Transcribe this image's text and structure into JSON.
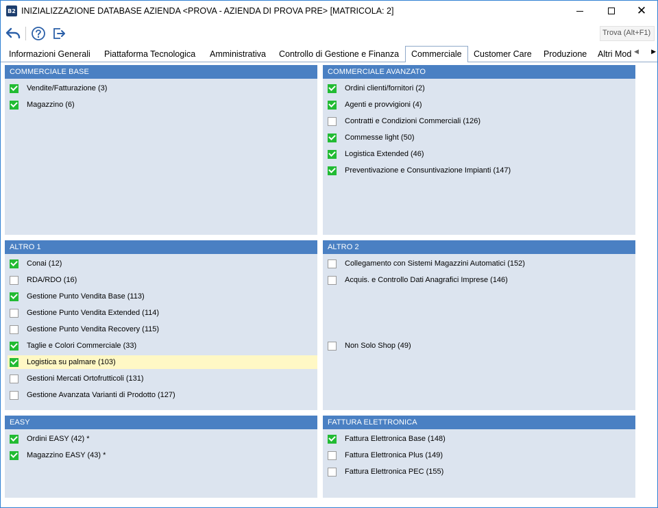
{
  "window": {
    "title": "INIZIALIZZAZIONE DATABASE AZIENDA <PROVA - AZIENDA DI PROVA PRE>   [MATRICOLA: 2]",
    "icon_text": "B2"
  },
  "toolbar": {
    "find_placeholder": "Trova (Alt+F1)"
  },
  "tabs": [
    {
      "label": "Informazioni Generali"
    },
    {
      "label": "Piattaforma Tecnologica"
    },
    {
      "label": "Amministrativa"
    },
    {
      "label": "Controllo di Gestione e Finanza"
    },
    {
      "label": "Commerciale"
    },
    {
      "label": "Customer Care"
    },
    {
      "label": "Produzione"
    },
    {
      "label": "Altri Mod"
    }
  ],
  "active_tab": "Commerciale",
  "panels": {
    "commerciale_base": {
      "title": "COMMERCIALE BASE",
      "items": [
        {
          "label": "Vendite/Fatturazione (3)",
          "checked": true
        },
        {
          "label": "Magazzino (6)",
          "checked": true
        }
      ]
    },
    "commerciale_avanzato": {
      "title": "COMMERCIALE AVANZATO",
      "items": [
        {
          "label": "Ordini clienti/fornitori (2)",
          "checked": true
        },
        {
          "label": "Agenti e provvigioni (4)",
          "checked": true
        },
        {
          "label": "Contratti e Condizioni Commerciali (126)",
          "checked": false
        },
        {
          "label": "Commesse light (50)",
          "checked": true
        },
        {
          "label": "Logistica Extended (46)",
          "checked": true
        },
        {
          "label": "Preventivazione e Consuntivazione Impianti (147)",
          "checked": true
        }
      ]
    },
    "altro_1": {
      "title": "ALTRO 1",
      "items": [
        {
          "label": "Conai (12)",
          "checked": true
        },
        {
          "label": "RDA/RDO (16)",
          "checked": false
        },
        {
          "label": "Gestione Punto Vendita Base (113)",
          "checked": true
        },
        {
          "label": "Gestione Punto Vendita Extended (114)",
          "checked": false
        },
        {
          "label": "Gestione Punto Vendita Recovery (115)",
          "checked": false
        },
        {
          "label": "Taglie e Colori Commerciale (33)",
          "checked": true
        },
        {
          "label": "Logistica su palmare (103)",
          "checked": true
        },
        {
          "label": "Gestioni Mercati Ortofrutticoli (131)",
          "checked": false
        },
        {
          "label": "Gestione Avanzata Varianti di Prodotto (127)",
          "checked": false
        }
      ]
    },
    "altro_2": {
      "title": "ALTRO 2",
      "items": [
        {
          "label": "Collegamento con Sistemi Magazzini Automatici (152)",
          "checked": false
        },
        {
          "label": "Acquis. e Controllo Dati Anagrafici Imprese (146)",
          "checked": false
        },
        {
          "label": "Non Solo Shop (49)",
          "checked": false
        }
      ]
    },
    "easy": {
      "title": "EASY",
      "items": [
        {
          "label": "Ordini EASY (42) *",
          "checked": true
        },
        {
          "label": "Magazzino EASY (43) *",
          "checked": true
        }
      ]
    },
    "fattura_elettronica": {
      "title": "FATTURA ELETTRONICA",
      "items": [
        {
          "label": "Fattura Elettronica Base (148)",
          "checked": true
        },
        {
          "label": "Fattura Elettronica Plus (149)",
          "checked": false
        },
        {
          "label": "Fattura Elettronica PEC (155)",
          "checked": false
        }
      ]
    }
  },
  "colors": {
    "panel_header": "#4a80c3",
    "panel_body": "#dce4ef",
    "checkbox_on": "#22bb33",
    "highlight_row": "#fff8c5"
  }
}
